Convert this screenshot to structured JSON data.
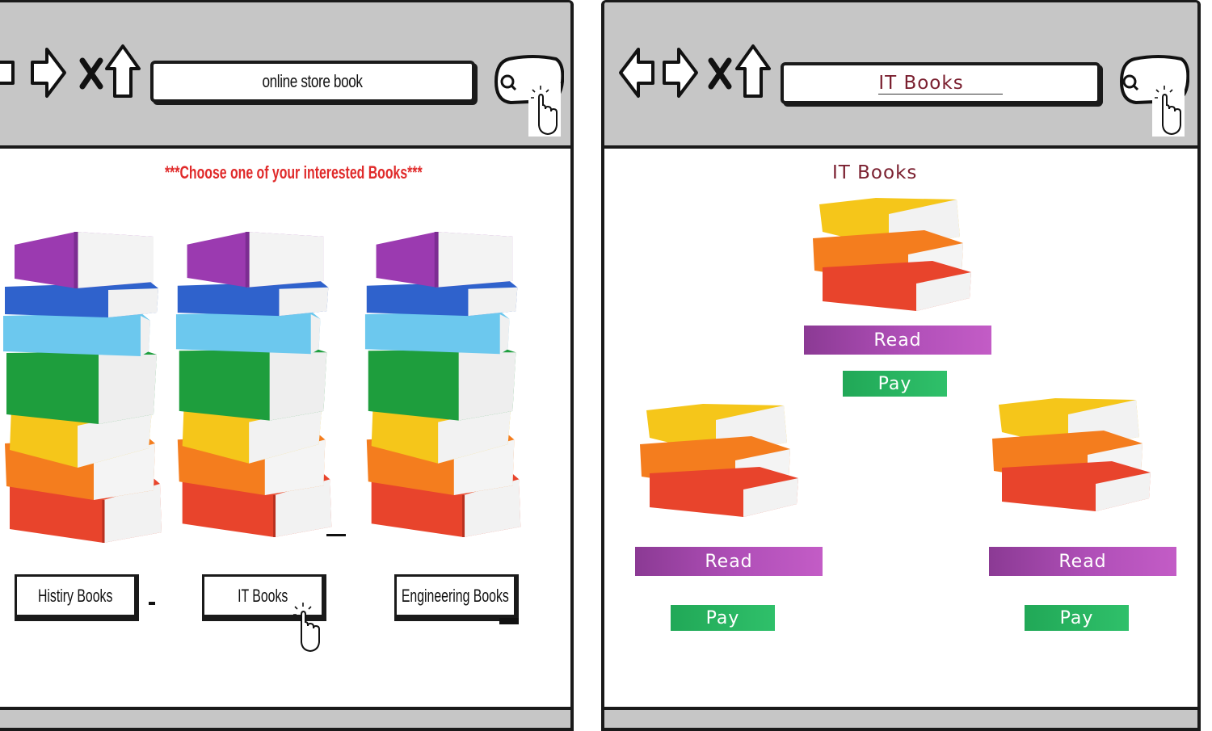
{
  "left_window": {
    "address_bar": {
      "value": "online store book"
    },
    "headline": "***Choose one of your interested Books***",
    "categories": [
      {
        "label": "Histiry Books"
      },
      {
        "label": "IT Books"
      },
      {
        "label": "Engineering Books"
      }
    ]
  },
  "right_window": {
    "address_bar": {
      "value": "IT Books"
    },
    "heading": "IT Books",
    "books": [
      {
        "read_label": "Read",
        "pay_label": "Pay"
      },
      {
        "read_label": "Read",
        "pay_label": "Pay"
      },
      {
        "read_label": "Read",
        "pay_label": "Pay"
      }
    ]
  },
  "icons": [
    "back-arrow-icon",
    "forward-arrow-icon",
    "close-x-icon",
    "home-icon",
    "search-icon",
    "hand-pointer-icon",
    "book-stack-image"
  ],
  "colors": {
    "toolbar": "#c6c6c6",
    "headline": "#e02a2a",
    "heading": "#7a1f2f",
    "read_button": "#a646ad",
    "pay_button": "#27b560"
  }
}
